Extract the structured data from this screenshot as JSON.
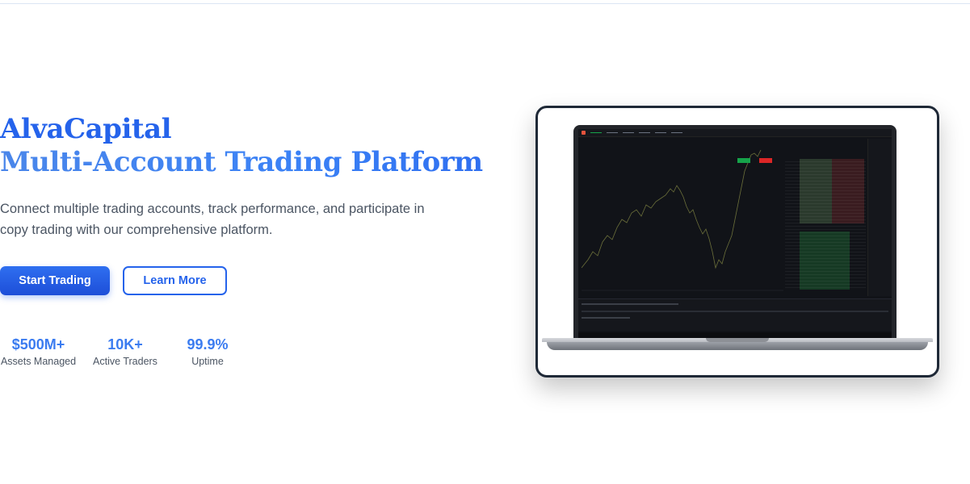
{
  "hero": {
    "brand": "AlvaCapital",
    "headline": "Multi-Account Trading Platform",
    "description": "Connect multiple trading accounts, track performance, and participate in copy trading with our comprehensive platform."
  },
  "buttons": {
    "primary": "Start Trading",
    "secondary": "Learn More"
  },
  "stats": [
    {
      "value": "$500M+",
      "label": "Assets Managed"
    },
    {
      "value": "10K+",
      "label": "Active Traders"
    },
    {
      "value": "99.9%",
      "label": "Uptime"
    }
  ],
  "colors": {
    "accent": "#2563eb",
    "accent_light": "#3b82f6",
    "text": "#4b5563",
    "frame_border": "#1f2937"
  },
  "illustration": {
    "description_icon": "laptop-trading-screen"
  }
}
